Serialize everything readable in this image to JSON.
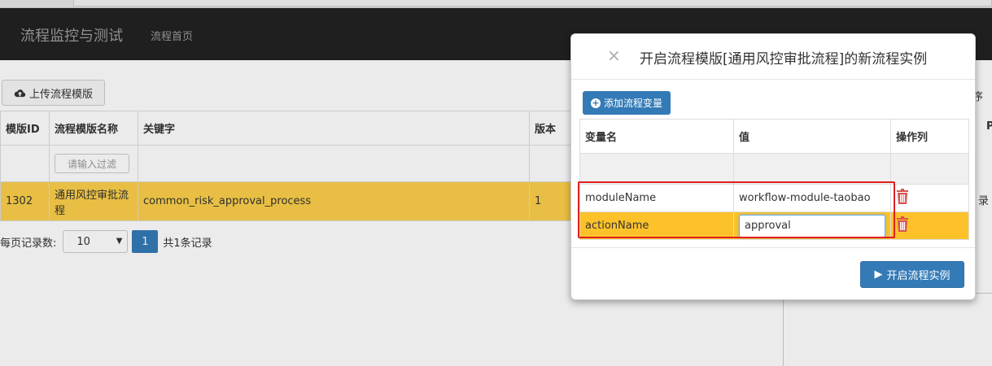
{
  "navbar": {
    "brand": "流程监控与测试",
    "home_link": "流程首页"
  },
  "toolbar": {
    "upload_label": "上传流程模版"
  },
  "template_table": {
    "columns": [
      "模版ID",
      "流程模版名称",
      "关键字",
      "版本"
    ],
    "filter_placeholder": "请输入过滤",
    "rows": [
      {
        "id": "1302",
        "name": "通用风控审批流程",
        "key": "common_risk_approval_process",
        "version": "1"
      }
    ]
  },
  "pagination": {
    "page_size_label": "每页记录数:",
    "page_size": "10",
    "current_page": "1",
    "total_text": "共1条记录"
  },
  "peek": {
    "text_a": "序",
    "text_b": "P",
    "text_c": "录"
  },
  "modal": {
    "title": "开启流程模版[通用风控审批流程]的新流程实例",
    "close_symbol": "×",
    "add_variable_label": "添加流程变量",
    "columns": [
      "变量名",
      "值",
      "操作列"
    ],
    "variables": [
      {
        "name": "moduleName",
        "value": "workflow-module-taobao"
      },
      {
        "name": "actionName",
        "value": "approval"
      }
    ],
    "start_label": "开启流程实例"
  },
  "colors": {
    "primary": "#337ab7",
    "highlight_row": "#fcd04a",
    "navbar": "#222222",
    "trash": "#d9534f",
    "annotation_box": "#e02020"
  }
}
